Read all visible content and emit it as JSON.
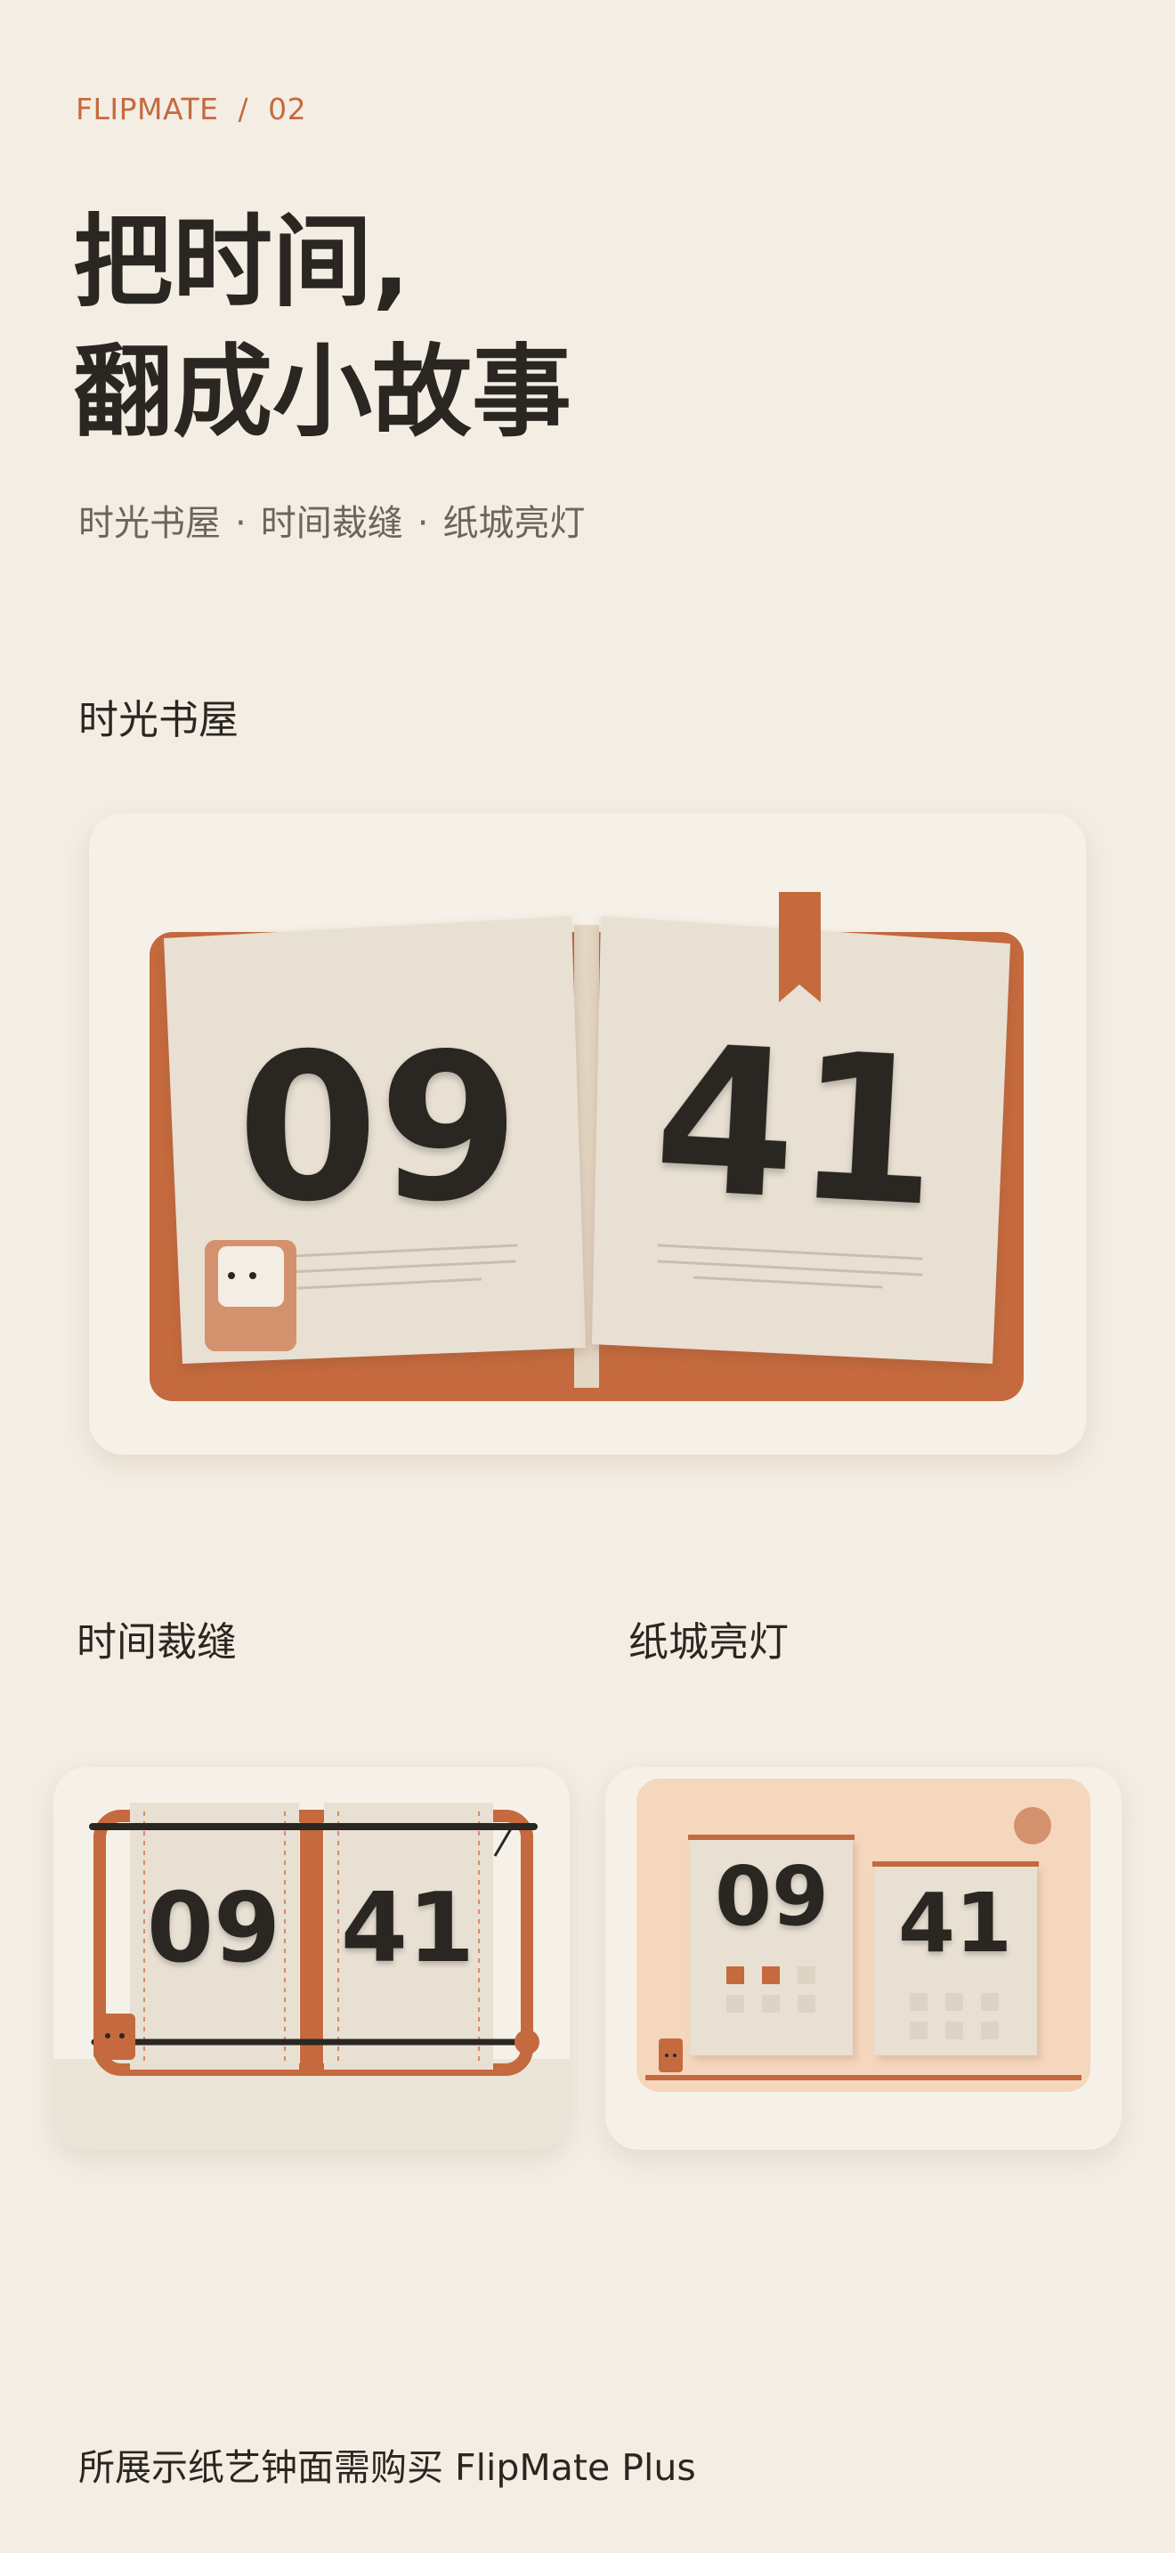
{
  "header": {
    "brand": "FLIPMATE",
    "separator": "/",
    "index": "02",
    "title_line1": "把时间,",
    "title_line2": "翻成小故事",
    "subtitle_items": [
      "时光书屋",
      "时间裁缝",
      "纸城亮灯"
    ],
    "subtitle_separator": "·"
  },
  "faces": [
    {
      "label": "时光书屋",
      "hour": "09",
      "minute": "41"
    },
    {
      "label": "时间裁缝",
      "hour": "09",
      "minute": "41"
    },
    {
      "label": "纸城亮灯",
      "hour": "09",
      "minute": "41"
    }
  ],
  "footer": {
    "note": "所展示纸艺钟面需购买 FlipMate Plus"
  },
  "colors": {
    "background": "#f4ede3",
    "accent": "#c56a3e",
    "text": "#2a2722",
    "card": "#f6f1e8",
    "paper": "#e8e0d2"
  }
}
